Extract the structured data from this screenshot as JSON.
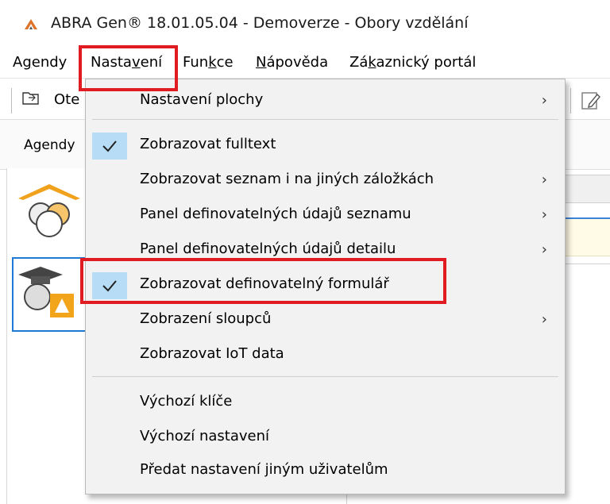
{
  "window": {
    "title": "ABRA Gen® 18.01.05.04 - Demoverze - Obory vzdělání",
    "icon": "abra-logo-icon"
  },
  "menubar": {
    "items": [
      {
        "label": "Agendy",
        "underline_index": 1
      },
      {
        "label": "Nastavení",
        "underline_index": 5
      },
      {
        "label": "Funkce",
        "underline_index": 3
      },
      {
        "label": "Nápověda",
        "underline_index": 0
      },
      {
        "label": "Zákaznický portál",
        "underline_index": 2
      }
    ]
  },
  "toolbar": {
    "open_label": "Ote"
  },
  "agendy_bar": {
    "label": "Agendy"
  },
  "dropdown": {
    "items": [
      {
        "label": "Nastavení plochy",
        "checked": false,
        "submenu": true
      },
      {
        "label": "Zobrazovat fulltext",
        "checked": true,
        "submenu": false
      },
      {
        "label": "Zobrazovat seznam i na jiných záložkách",
        "checked": false,
        "submenu": true
      },
      {
        "label": "Panel definovatelných údajů seznamu",
        "checked": false,
        "submenu": true
      },
      {
        "label": "Panel definovatelných údajů detailu",
        "checked": false,
        "submenu": true
      },
      {
        "label": "Zobrazovat definovatelný formulář",
        "checked": true,
        "submenu": false
      },
      {
        "label": "Zobrazení sloupců",
        "checked": false,
        "submenu": true
      },
      {
        "label": "Zobrazovat IoT data",
        "checked": false,
        "submenu": false
      },
      {
        "label": "Výchozí klíče",
        "checked": false,
        "submenu": false
      },
      {
        "label": "Výchozí nastavení",
        "checked": false,
        "submenu": false
      },
      {
        "label": "Předat nastavení jiným uživatelům",
        "checked": false,
        "submenu": false
      }
    ],
    "arrow_glyph": "›"
  },
  "colors": {
    "highlight_box": "#e11b22",
    "check_bg": "#b7dcf6",
    "selection_border": "#1e7ad4",
    "app_icon": "#e0732a"
  }
}
